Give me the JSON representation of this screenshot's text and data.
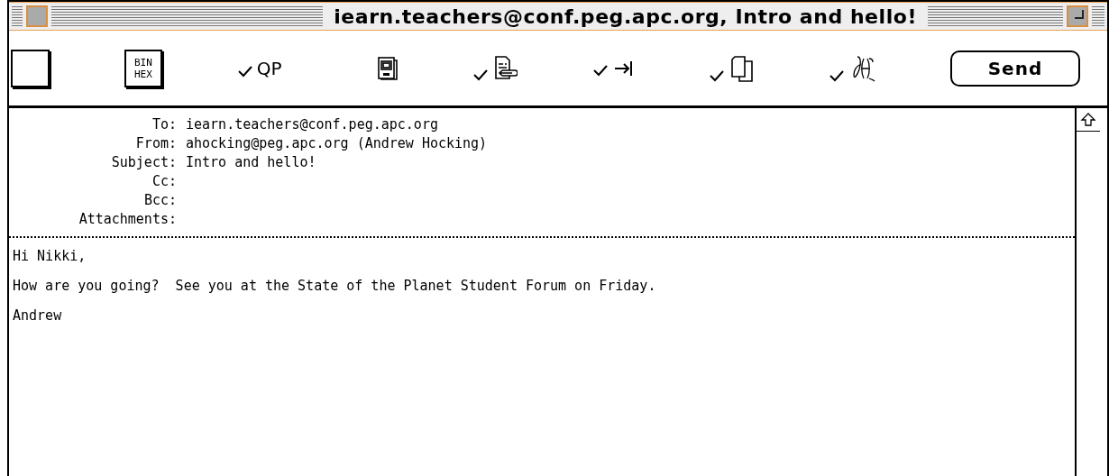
{
  "window": {
    "title": "iearn.teachers@conf.peg.apc.org, Intro and hello!"
  },
  "toolbar": [
    {
      "kind": "blank"
    },
    {
      "kind": "binhex",
      "lines": [
        "BIN",
        "HEX"
      ]
    },
    {
      "kind": "text",
      "label": "QP",
      "checked": true
    },
    {
      "kind": "document",
      "checked": false
    },
    {
      "kind": "attach",
      "checked": true
    },
    {
      "kind": "tab",
      "checked": true
    },
    {
      "kind": "pages",
      "checked": true
    },
    {
      "kind": "signature",
      "checked": true
    },
    {
      "kind": "send",
      "label": "Send"
    }
  ],
  "headers": [
    {
      "label": "To:",
      "value": "iearn.teachers@conf.peg.apc.org"
    },
    {
      "label": "From:",
      "value": "ahocking@peg.apc.org (Andrew Hocking)"
    },
    {
      "label": "Subject:",
      "value": "Intro and hello!"
    },
    {
      "label": "Cc:"
    },
    {
      "label": "Bcc:"
    },
    {
      "label": "Attachments:"
    }
  ],
  "body": [
    "Hi Nikki,",
    "How are you going?  See you at the State of the Planet Student Forum on Friday.",
    "Andrew"
  ]
}
